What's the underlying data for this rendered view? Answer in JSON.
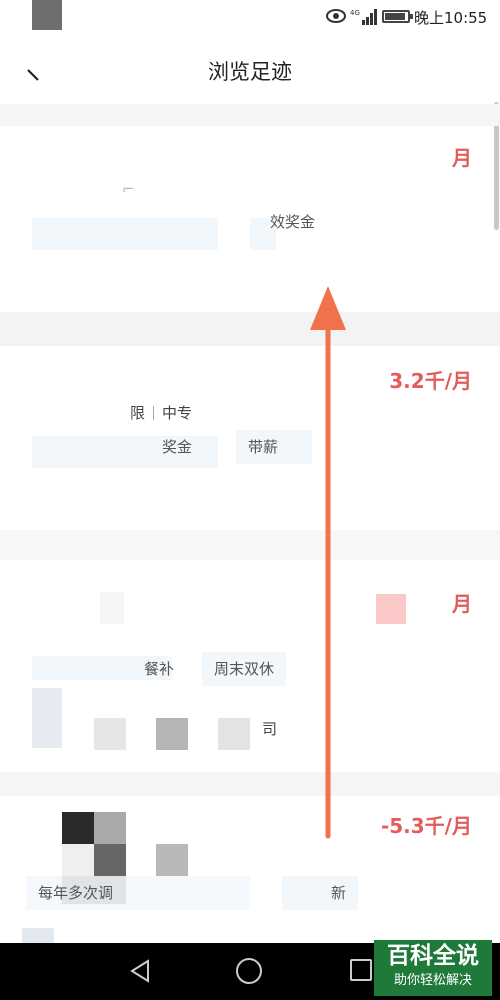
{
  "status_bar": {
    "network_label": "4G",
    "time": "晚上10:55",
    "icons": [
      "eye-icon",
      "signal-icon",
      "battery-icon"
    ]
  },
  "header": {
    "title": "浏览足迹",
    "back_icon": "back-arrow-icon"
  },
  "jobs": [
    {
      "salary": "月",
      "fragment": "⌐",
      "tags": [
        "",
        "效奖金"
      ]
    },
    {
      "salary": "3.2千/月",
      "meta": [
        "限",
        "中专"
      ],
      "tags": [
        "奖金",
        "带薪"
      ]
    },
    {
      "salary": "月",
      "tags": [
        "餐补",
        "周末双休"
      ],
      "company_fragment": "司"
    },
    {
      "salary": "-5.3千/月",
      "tags": [
        "每年多次调",
        "新"
      ]
    }
  ],
  "overlay": {
    "arrow_color": "#f0714a",
    "arrow_icon": "up-arrow-icon"
  },
  "nav_bar": {
    "icons": [
      "nav-back-icon",
      "nav-home-icon",
      "nav-recent-icon"
    ]
  },
  "watermark": {
    "main": "百科全说",
    "sub": "助你轻松解决"
  },
  "colors": {
    "salary": "#e25c5c",
    "tag_bg": "#f2f7fc",
    "watermark_bg": "#1f7a3a"
  }
}
